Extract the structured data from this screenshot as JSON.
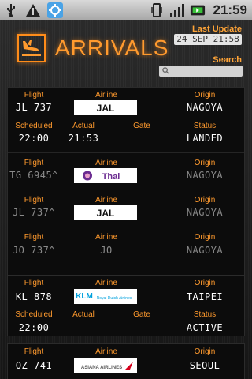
{
  "status_bar": {
    "time": "21:59",
    "icons": [
      "usb-icon",
      "warning-icon",
      "sync-icon",
      "vibrate-icon",
      "signal-icon",
      "battery-icon"
    ]
  },
  "header": {
    "title": "ARRIVALS",
    "last_update_label": "Last Update",
    "last_update_value": "24 SEP 21:58",
    "search_label": "Search",
    "search_placeholder": ""
  },
  "labels": {
    "flight": "Flight",
    "airline": "Airline",
    "origin": "Origin",
    "scheduled": "Scheduled",
    "actual": "Actual",
    "gate": "Gate",
    "status": "Status"
  },
  "groups": [
    {
      "flights": [
        {
          "flight": "JL 737",
          "airline_logo": "JAL",
          "origin": "NAGOYA",
          "scheduled": "22:00",
          "actual": "21:53",
          "gate": "",
          "status": "LANDED",
          "dim": false
        },
        {
          "flight": "TG 6945^",
          "airline_logo": "Thai",
          "origin": "NAGOYA",
          "dim": true
        },
        {
          "flight": "JL 737^",
          "airline_logo": "JAL",
          "origin": "NAGOYA",
          "dim": true
        },
        {
          "flight": "JO 737^",
          "airline_text": "JO",
          "origin": "NAGOYA",
          "dim": true
        }
      ]
    },
    {
      "flights": [
        {
          "flight": "KL 878",
          "airline_logo": "KLM",
          "airline_subtitle": "Royal Dutch Airlines",
          "origin": "TAIPEI",
          "scheduled": "22:00",
          "actual": "",
          "gate": "",
          "status": "ACTIVE",
          "dim": false
        }
      ]
    },
    {
      "flights": [
        {
          "flight": "OZ 741",
          "airline_logo": "ASIANA AIRLINES",
          "origin": "SEOUL",
          "dim": false
        }
      ]
    }
  ],
  "colors": {
    "accent": "#ff9a2e",
    "value": "#ffffff",
    "dim_value": "#8a8a8a",
    "jal_red": "#d6001c",
    "thai_purple": "#6b2c91",
    "klm_blue": "#00a1de"
  }
}
